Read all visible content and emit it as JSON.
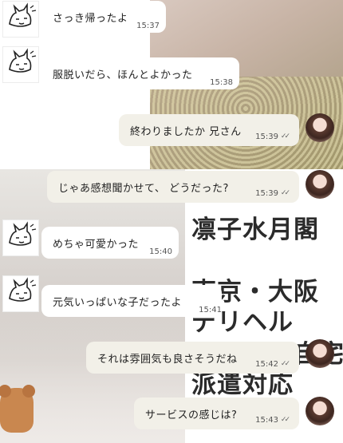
{
  "messages": [
    {
      "text": "さっき帰ったよ",
      "time": "15:37"
    },
    {
      "text": "服脱いだら、ほんとよかった",
      "time": "15:38"
    },
    {
      "text": "終わりましたか 兄さん",
      "time": "15:39"
    },
    {
      "text": "じゃあ感想聞かせて、 どうだった?",
      "time": "15:39"
    },
    {
      "text": "めちゃ可愛かった",
      "time": "15:40"
    },
    {
      "text": "元気いっぱいな子だったよ",
      "time": "15:41"
    },
    {
      "text": "それは雰囲気も良さそうだね",
      "time": "15:42"
    },
    {
      "text": "サービスの感じは?",
      "time": "15:43"
    }
  ],
  "receipt_icon": "double-check-icon",
  "receipt_glyph": "✓✓",
  "promo_lines": [
    "凛子水月閣",
    "東京・大阪",
    "デリヘル",
    "ホテル・自宅",
    "派遣対応"
  ]
}
